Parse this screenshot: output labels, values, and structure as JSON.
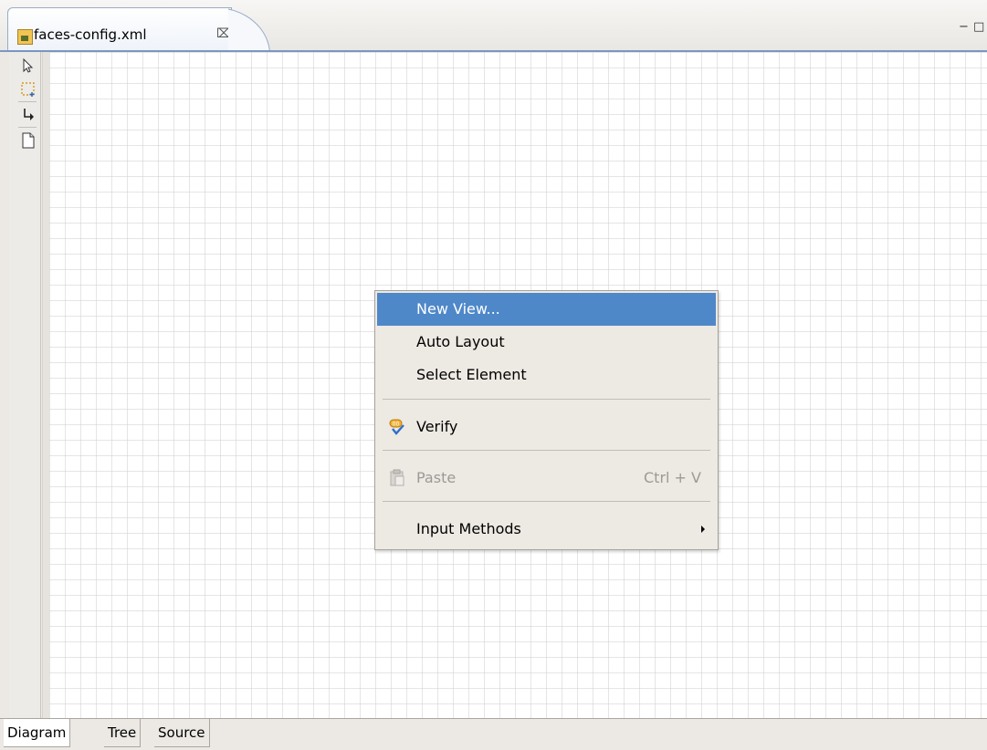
{
  "editor": {
    "tab_title": "faces-config.xml",
    "tab_close": "⌧",
    "minimize": "−",
    "maximize": "□"
  },
  "palette": {
    "tools": [
      "select-arrow-icon",
      "marquee-select-icon",
      "connection-icon",
      "new-view-icon"
    ]
  },
  "bottom_tabs": [
    "Diagram",
    "Tree",
    "Source"
  ],
  "context_menu": {
    "items": [
      {
        "label": "New View...",
        "highlighted": true
      },
      {
        "label": "Auto Layout"
      },
      {
        "label": "Select Element"
      },
      {
        "label": "Verify",
        "icon": "verify-icon"
      },
      {
        "label": "Paste",
        "shortcut": "Ctrl + V",
        "disabled": true,
        "icon": "paste-icon"
      },
      {
        "label": "Input Methods",
        "submenu": true
      }
    ]
  },
  "colors": {
    "highlight": "#4f88c9",
    "tab_border": "#9aabc6"
  }
}
